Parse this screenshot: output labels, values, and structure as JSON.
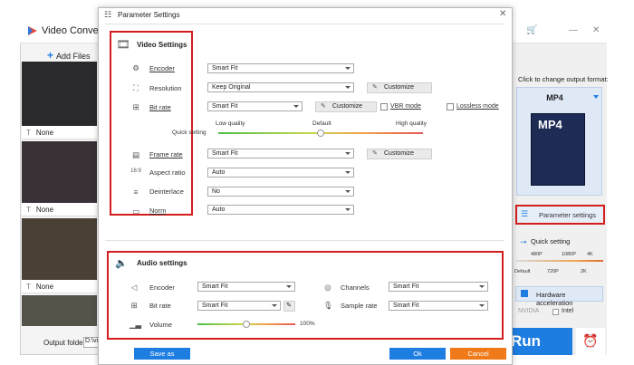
{
  "app": {
    "title": "Video Converter",
    "add_files": "Add Files",
    "none_label": "None",
    "output_folder_label": "Output folder:",
    "output_folder_value": "D:\\vi",
    "click_to_change": "Click to change output format:",
    "format": "MP4",
    "format_art_text": "MP4",
    "parameter_settings": "Parameter settings",
    "quick_setting": "Quick setting",
    "quick_ticks_top": [
      "480P",
      "1080P",
      "4K"
    ],
    "quick_ticks_bottom": [
      "Default",
      "720P",
      "2K"
    ],
    "hardware_acceleration": "Hardware acceleration",
    "nvidia": "NVIDIA",
    "intel": "Intel",
    "run": "Run"
  },
  "dialog": {
    "title": "Parameter Settings",
    "video": {
      "section_title": "Video Settings",
      "encoder_label": "Encoder",
      "encoder_value": "Smart Fit",
      "resolution_label": "Resolution",
      "resolution_value": "Keep Original",
      "customize": "Customize",
      "bitrate_label": "Bit rate",
      "bitrate_value": "Smart Fit",
      "vbr_mode": "VBR mode",
      "lossless_mode": "Lossless mode",
      "quality_low": "Low quality",
      "quality_default": "Default",
      "quality_high": "High quality",
      "quick_setting": "Quick setting",
      "framerate_label": "Frame rate",
      "framerate_value": "Smart Fit",
      "aspect_label": "Aspect ratio",
      "aspect_value": "Auto",
      "deinterlace_label": "Deinterlace",
      "deinterlace_value": "No",
      "norm_label": "Norm",
      "norm_value": "Auto",
      "quality_slider": 0.5
    },
    "audio": {
      "section_title": "Audio settings",
      "encoder_label": "Encoder",
      "encoder_value": "Smart Fit",
      "channels_label": "Channels",
      "channels_value": "Smart Fit",
      "bitrate_label": "Bit rate",
      "bitrate_value": "Smart Fit",
      "samplerate_label": "Sample rate",
      "samplerate_value": "Smart Fit",
      "volume_label": "Volume",
      "volume_value": "100%",
      "volume_level": 0.5
    },
    "save_as": "Save as",
    "ok": "Ok",
    "cancel": "Cancel"
  },
  "colors": {
    "accent": "#1e7de0",
    "annotation": "#d61d1d",
    "cancel": "#f07a1a"
  }
}
